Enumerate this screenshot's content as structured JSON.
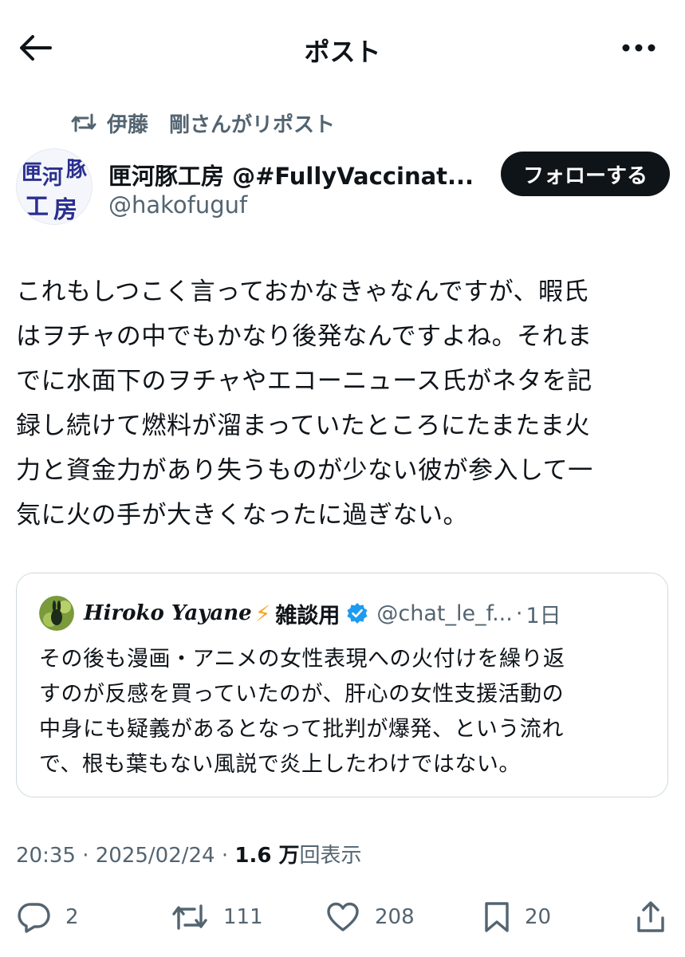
{
  "header": {
    "title": "ポスト"
  },
  "repost": {
    "text": "伊藤　剛さんがリポスト"
  },
  "author": {
    "display_name": "匣河豚工房 @#FullyVaccinat...",
    "handle": "@hakofuguf",
    "avatar_text": [
      "匣",
      "河",
      "豚",
      "工",
      "房"
    ],
    "follow_label": "フォローする"
  },
  "post": {
    "lines": [
      "これもしつこく言っておかなきゃなんですが、暇氏",
      "はヲチャの中でもかなり後発なんですよね。それま",
      "でに水面下のヲチャやエコーニュース氏がネタを記",
      "録し続けて燃料が溜まっていたところにたまたま火",
      "力と資金力があり失うものが少ない彼が参入して一",
      "気に火の手が大きくなったに過ぎない。"
    ]
  },
  "quote": {
    "name": "Hiroko Yayane",
    "bolt": "⚡",
    "name_suffix": "雑談用",
    "handle": "@chat_le_f...",
    "separator": "·",
    "time": "1日",
    "lines": [
      "その後も漫画・アニメの女性表現への火付けを繰り返",
      "すのが反感を買っていたのが、肝心の女性支援活動の",
      "中身にも疑義があるとなって批判が爆発、という流れ",
      "で、根も葉もない風説で炎上したわけではない。"
    ]
  },
  "meta": {
    "time": "20:35",
    "sep": " · ",
    "date": "2025/02/24",
    "views_count": "1.6 万",
    "views_label": "回表示"
  },
  "actions": {
    "replies": "2",
    "reposts": "111",
    "likes": "208",
    "bookmarks": "20"
  },
  "colors": {
    "text": "#0f1419",
    "secondary": "#536471",
    "border": "#cfd9de",
    "verified": "#1d9bf0",
    "bolt": "#f5a623"
  }
}
